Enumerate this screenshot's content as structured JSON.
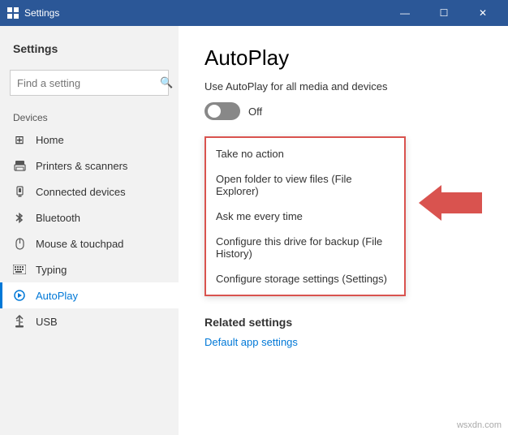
{
  "titlebar": {
    "title": "Settings",
    "min_label": "—",
    "max_label": "☐",
    "close_label": "✕"
  },
  "sidebar": {
    "header": "Settings",
    "search_placeholder": "Find a setting",
    "section_label": "Devices",
    "items": [
      {
        "id": "home",
        "label": "Home",
        "icon": "⊞"
      },
      {
        "id": "printers",
        "label": "Printers & scanners",
        "icon": "🖨"
      },
      {
        "id": "connected",
        "label": "Connected devices",
        "icon": "📱"
      },
      {
        "id": "bluetooth",
        "label": "Bluetooth",
        "icon": "⚡"
      },
      {
        "id": "mouse",
        "label": "Mouse & touchpad",
        "icon": "🖱"
      },
      {
        "id": "typing",
        "label": "Typing",
        "icon": "⌨"
      },
      {
        "id": "autoplay",
        "label": "AutoPlay",
        "icon": "↻",
        "active": true
      },
      {
        "id": "usb",
        "label": "USB",
        "icon": "⚡"
      }
    ]
  },
  "content": {
    "page_title": "AutoPlay",
    "description": "Use AutoPlay for all media and devices",
    "toggle_state": "Off",
    "dropdown": {
      "items": [
        "Take no action",
        "Open folder to view files (File Explorer)",
        "Ask me every time",
        "Configure this drive for backup (File History)",
        "Configure storage settings (Settings)"
      ]
    },
    "related_settings": {
      "title": "Related settings",
      "link": "Default app settings"
    }
  },
  "watermark": "wsxdn.com"
}
